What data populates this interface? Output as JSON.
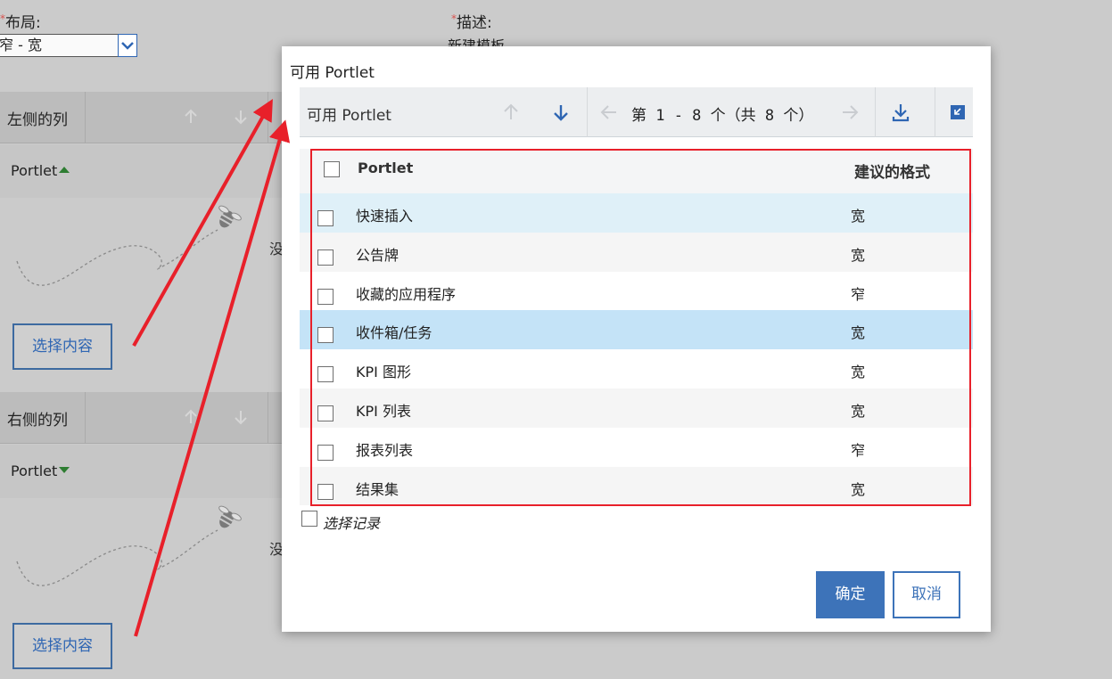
{
  "background": {
    "layout_label": "布局:",
    "layout_value": "窄 - 宽",
    "description_label": "描述:",
    "description_value": "新建模板",
    "required_mark": "*",
    "columns": [
      {
        "title": "左侧的列",
        "portlet_label": "Portlet",
        "sort": "asc",
        "empty_hint": "没",
        "select_button": "选择内容"
      },
      {
        "title": "右侧的列",
        "portlet_label": "Portlet",
        "sort": "desc",
        "empty_hint": "没",
        "select_button": "选择内容"
      }
    ]
  },
  "dialog": {
    "title": "可用 Portlet",
    "toolbar": {
      "title": "可用 Portlet",
      "pager": "第 1 - 8 个（共 8 个）",
      "icons": [
        "arrow-up-icon",
        "arrow-down-icon",
        "arrow-left-icon",
        "arrow-right-icon",
        "download-icon",
        "collapse-icon"
      ]
    },
    "grid": {
      "headers": {
        "portlet": "Portlet",
        "format": "建议的格式"
      },
      "rows": [
        {
          "name": "快速插入",
          "format": "宽",
          "state": "hover"
        },
        {
          "name": "公告牌",
          "format": "宽",
          "state": "alt"
        },
        {
          "name": "收藏的应用程序",
          "format": "窄",
          "state": "normal"
        },
        {
          "name": "收件箱/任务",
          "format": "宽",
          "state": "selected"
        },
        {
          "name": "KPI 图形",
          "format": "宽",
          "state": "normal"
        },
        {
          "name": "KPI 列表",
          "format": "宽",
          "state": "alt"
        },
        {
          "name": "报表列表",
          "format": "窄",
          "state": "normal"
        },
        {
          "name": "结果集",
          "format": "宽",
          "state": "alt"
        }
      ]
    },
    "select_records_label": "选择记录",
    "ok_label": "确定",
    "cancel_label": "取消"
  },
  "colors": {
    "accent": "#3d73b9",
    "annotation_red": "#e8202a",
    "row_hover": "#dff0f8",
    "row_selected": "#c4e3f7",
    "sort_arrow_green": "#2e7d32"
  }
}
